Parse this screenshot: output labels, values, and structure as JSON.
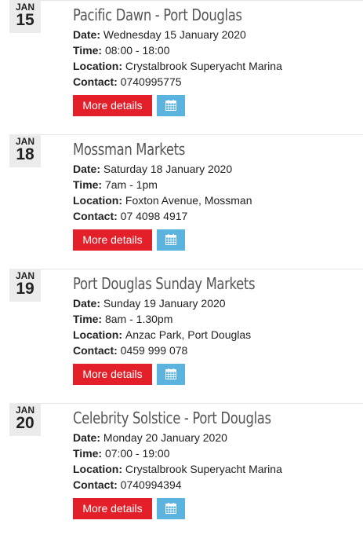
{
  "labels": {
    "date": "Date:",
    "time": "Time:",
    "location": "Location:",
    "contact": "Contact:",
    "more_details": "More details"
  },
  "icons": {
    "calendar": "calendar-icon",
    "calendar_button_color": "#5bb3e0",
    "more_button_color": "#e3202a"
  },
  "events": [
    {
      "month": "JAN",
      "day": "15",
      "title": "Pacific Dawn - Port Douglas",
      "date": "Wednesday 15 January 2020",
      "time": "08:00 - 18:00",
      "location": "Crystalbrook Superyacht Marina",
      "contact": "0740995775"
    },
    {
      "month": "JAN",
      "day": "18",
      "title": "Mossman Markets",
      "date": "Saturday 18 January 2020",
      "time": "7am - 1pm",
      "location": "Foxton Avenue, Mossman",
      "contact": "07 4098 4917"
    },
    {
      "month": "JAN",
      "day": "19",
      "title": "Port Douglas Sunday Markets",
      "date": "Sunday 19 January 2020",
      "time": "8am - 1.30pm",
      "location": "Anzac Park, Port Douglas",
      "contact": "0459 999 078"
    },
    {
      "month": "JAN",
      "day": "20",
      "title": "Celebrity Solstice - Port Douglas",
      "date": "Monday 20 January 2020",
      "time": "07:00 - 19:00",
      "location": "Crystalbrook Superyacht Marina",
      "contact": "0740994394"
    }
  ]
}
